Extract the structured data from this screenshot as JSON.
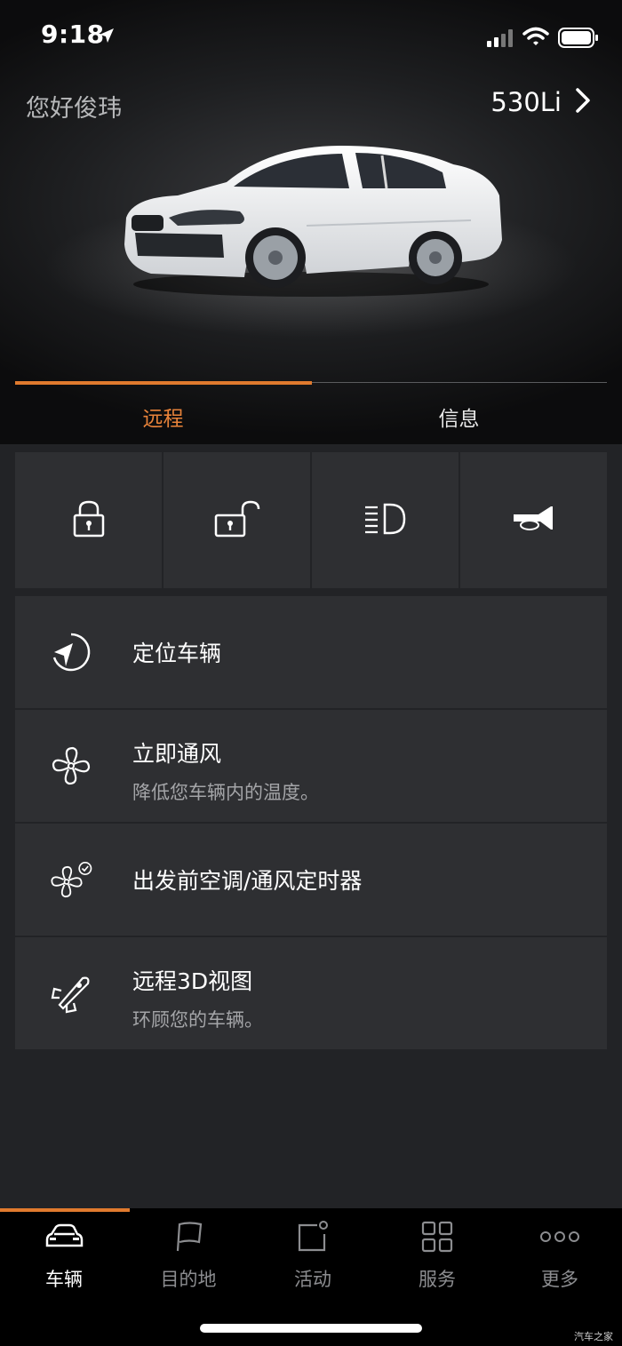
{
  "status": {
    "time": "9:18"
  },
  "header": {
    "greeting": "您好俊玮",
    "model": "530Li"
  },
  "tabs": [
    {
      "label": "远程",
      "active": true
    },
    {
      "label": "信息",
      "active": false
    }
  ],
  "quick_actions": [
    {
      "icon": "lock-icon"
    },
    {
      "icon": "unlock-icon"
    },
    {
      "icon": "headlight-icon"
    },
    {
      "icon": "horn-icon"
    }
  ],
  "list": [
    {
      "icon": "locate-icon",
      "title": "定位车辆",
      "subtitle": ""
    },
    {
      "icon": "fan-icon",
      "title": "立即通风",
      "subtitle": "降低您车辆内的温度。"
    },
    {
      "icon": "fan-timer-icon",
      "title": "出发前空调/通风定时器",
      "subtitle": ""
    },
    {
      "icon": "remote-3d-icon",
      "title": "远程3D视图",
      "subtitle": "环顾您的车辆。"
    }
  ],
  "bottom_nav": [
    {
      "icon": "car-icon",
      "label": "车辆",
      "active": true
    },
    {
      "icon": "flag-icon",
      "label": "目的地",
      "active": false
    },
    {
      "icon": "activity-icon",
      "label": "活动",
      "active": false
    },
    {
      "icon": "grid-icon",
      "label": "服务",
      "active": false
    },
    {
      "icon": "more-dots-icon",
      "label": "更多",
      "active": false
    }
  ],
  "colors": {
    "accent": "#e07a2e",
    "background": "#222326",
    "card": "#2e2f32"
  },
  "watermark": "汽车之家"
}
